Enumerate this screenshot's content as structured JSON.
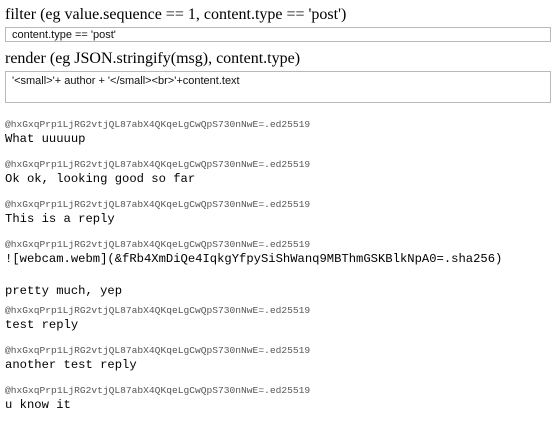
{
  "filter": {
    "label": "filter (eg value.sequence == 1, content.type == 'post')",
    "value": "content.type == 'post'"
  },
  "render": {
    "label": "render (eg JSON.stringify(msg), content.type)",
    "value": "'<small>'+ author + '</small><br>'+content.text"
  },
  "messages": [
    {
      "author": "@hxGxqPrp1LjRG2vtjQL87abX4QKqeLgCwQpS730nNwE=.ed25519",
      "text": "What uuuuup"
    },
    {
      "author": "@hxGxqPrp1LjRG2vtjQL87abX4QKqeLgCwQpS730nNwE=.ed25519",
      "text": "Ok ok, looking good so far"
    },
    {
      "author": "@hxGxqPrp1LjRG2vtjQL87abX4QKqeLgCwQpS730nNwE=.ed25519",
      "text": "This is a reply"
    },
    {
      "author": "@hxGxqPrp1LjRG2vtjQL87abX4QKqeLgCwQpS730nNwE=.ed25519",
      "text": "![webcam.webm](&fRb4XmDiQe4IqkgYfpySiShWanq9MBThmGSKBlkNpA0=.sha256)",
      "text2": "pretty much, yep"
    },
    {
      "author": "@hxGxqPrp1LjRG2vtjQL87abX4QKqeLgCwQpS730nNwE=.ed25519",
      "text": "test reply"
    },
    {
      "author": "@hxGxqPrp1LjRG2vtjQL87abX4QKqeLgCwQpS730nNwE=.ed25519",
      "text": "another test reply"
    },
    {
      "author": "@hxGxqPrp1LjRG2vtjQL87abX4QKqeLgCwQpS730nNwE=.ed25519",
      "text": "u know it"
    }
  ]
}
